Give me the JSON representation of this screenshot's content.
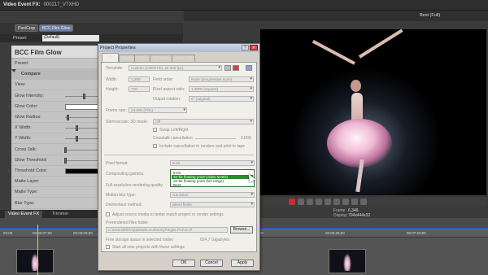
{
  "app": {
    "fx_title": "Video Event FX:",
    "fx_event": "000217_VTXHD",
    "chain_buttons": [
      "Pan/Crop",
      "BCC Film Glow"
    ],
    "preset_label": "Preset:",
    "preset_value": "(Default)",
    "quality": "Best (Full)"
  },
  "fx_panel": {
    "name": "BCC Film Glow",
    "params": [
      {
        "label": "Preset:",
        "kind": "text"
      },
      {
        "label": "Compare",
        "kind": "section"
      },
      {
        "label": "View:",
        "kind": "text"
      },
      {
        "label": "Glow Intensity:",
        "kind": "slider",
        "level": 0.55
      },
      {
        "label": "Glow Color:",
        "kind": "color",
        "color": "#ffffff"
      },
      {
        "label": "Glow Radius:",
        "kind": "slider",
        "level": 0.08
      },
      {
        "label": "X Width:",
        "kind": "slider",
        "level": 0.35
      },
      {
        "label": "Y Width:",
        "kind": "slider",
        "level": 0.35
      },
      {
        "label": "Cross Talk:",
        "kind": "slider",
        "level": 0.02
      },
      {
        "label": "Glow Threshold:",
        "kind": "slider",
        "level": 0.02
      },
      {
        "label": "Threshold Color:",
        "kind": "color",
        "color": "#000000"
      },
      {
        "label": "Matte Layer:",
        "kind": "text"
      },
      {
        "label": "Matte Type:",
        "kind": "text"
      },
      {
        "label": "Blur Type:",
        "kind": "text"
      }
    ]
  },
  "bottom_tabs": [
    "Video Event FX",
    "Trimmer"
  ],
  "timeline": {
    "ticks": [
      "00:00",
      "00:00:07;00",
      "00:00:08;00",
      "00:01:24;00",
      "00:03:20;00",
      "00:05:28;00",
      "00:07:23;00"
    ]
  },
  "frame_info": {
    "frame_label": "Frame:",
    "frame_value": "6,346",
    "display_label": "Display:",
    "display_value": "704x444x32"
  },
  "dialog": {
    "title": "Project Properties",
    "help": "?",
    "close": "✕",
    "tabs": [
      "Video",
      "Audio",
      "Ruler",
      "Summary",
      "Audio CD"
    ],
    "active_tab": "Video",
    "template_label": "Template:",
    "template_value": "Custom (1280x720, 24.000 fps)",
    "width_label": "Width:",
    "width_value": "1,280",
    "field_order_label": "Field order:",
    "field_order_value": "None (progressive scan)",
    "height_label": "Height:",
    "height_value": "720",
    "pixel_aspect_label": "Pixel aspect ratio:",
    "pixel_aspect_value": "1.0000 (Square)",
    "output_rotation_label": "Output rotation:",
    "output_rotation_value": "0° (original)",
    "frame_rate_label": "Frame rate:",
    "frame_rate_value": "24.000 (Film)",
    "stereo_label": "Stereoscopic 3D mode:",
    "stereo_value": "Off",
    "swap_lr": "Swap Left/Right",
    "crosstalk_label": "Crosstalk cancellation:",
    "crosstalk_value": "0.000",
    "include_crosstalk": "Include cancellation in renders and print to tape",
    "pixel_format_label": "Pixel format:",
    "pixel_format_value": "8-bit",
    "compositing_gamma_label": "Compositing gamma:",
    "fullres_label": "Full-resolution rendering quality:",
    "motion_blur_label": "Motion blur type:",
    "motion_blur_value": "Gaussian",
    "deinterlace_label": "Deinterlace method:",
    "deinterlace_value": "Blend fields",
    "dropdown_options": [
      "8-bit",
      "32-bit floating point (video levels)",
      "32-bit floating point (full range)",
      "Best"
    ],
    "dropdown_selected": 1,
    "adjust_source": "Adjust source media to better match project or render settings",
    "prerendered_label": "Prerendered files folder:",
    "prerendered_path": "C:\\Users\\Eliz\\AppData\\Local\\Sony\\Vegas Pro\\11.0\\",
    "browse": "Browse...",
    "free_storage_label": "Free storage space in selected folder:",
    "free_storage_value": "624.7 Gigabytes",
    "start_all": "Start all new projects with these settings",
    "ok": "OK",
    "cancel": "Cancel",
    "apply": "Apply"
  },
  "colors": {
    "accent_green": "#2a8b2a",
    "playhead": "#e0e000",
    "close_red": "#d34a3e"
  }
}
